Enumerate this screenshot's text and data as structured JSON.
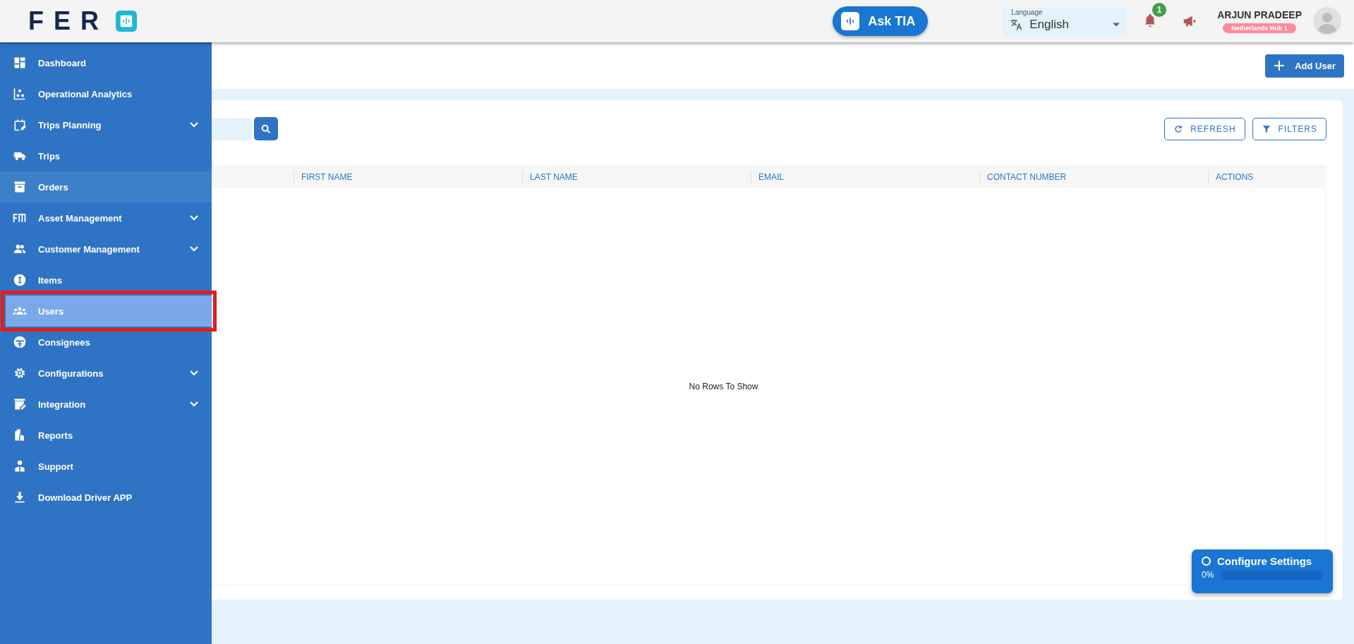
{
  "header": {
    "logo": "FER",
    "ask_button": "Ask TIA",
    "language": {
      "label": "Language",
      "value": "English"
    },
    "notification_count": "1",
    "user": {
      "name": "ARJUN PRADEEP",
      "hub": "Netherlands Hub 1"
    }
  },
  "sidebar": {
    "items": [
      {
        "label": "Dashboard",
        "kind": "dashboard",
        "expandable": false,
        "selected": false,
        "hovered": false,
        "marked": false
      },
      {
        "label": "Operational Analytics",
        "kind": "analytics",
        "expandable": false,
        "selected": false,
        "hovered": false,
        "marked": false
      },
      {
        "label": "Trips Planning",
        "kind": "calendar",
        "expandable": true,
        "selected": false,
        "hovered": false,
        "marked": false
      },
      {
        "label": "Trips",
        "kind": "truck",
        "expandable": false,
        "selected": false,
        "hovered": false,
        "marked": false
      },
      {
        "label": "Orders",
        "kind": "archive",
        "expandable": false,
        "selected": false,
        "hovered": true,
        "marked": false
      },
      {
        "label": "Asset Management",
        "kind": "fm",
        "expandable": true,
        "selected": false,
        "hovered": false,
        "marked": false
      },
      {
        "label": "Customer Management",
        "kind": "people",
        "expandable": true,
        "selected": false,
        "hovered": false,
        "marked": false
      },
      {
        "label": "Items",
        "kind": "info",
        "expandable": false,
        "selected": false,
        "hovered": false,
        "marked": false
      },
      {
        "label": "Users",
        "kind": "group",
        "expandable": false,
        "selected": true,
        "hovered": false,
        "marked": true
      },
      {
        "label": "Consignees",
        "kind": "face",
        "expandable": false,
        "selected": false,
        "hovered": false,
        "marked": false
      },
      {
        "label": "Configurations",
        "kind": "gear",
        "expandable": true,
        "selected": false,
        "hovered": false,
        "marked": false
      },
      {
        "label": "Integration",
        "kind": "edit",
        "expandable": true,
        "selected": false,
        "hovered": false,
        "marked": false
      },
      {
        "label": "Reports",
        "kind": "clipboard",
        "expandable": false,
        "selected": false,
        "hovered": false,
        "marked": false
      },
      {
        "label": "Support",
        "kind": "person",
        "expandable": false,
        "selected": false,
        "hovered": false,
        "marked": false
      },
      {
        "label": "Download Driver APP",
        "kind": "download",
        "expandable": false,
        "selected": false,
        "hovered": false,
        "marked": false
      }
    ]
  },
  "toolbar": {
    "add_button": "Add User"
  },
  "table": {
    "buttons": [
      {
        "label": "REFRESH",
        "kind": "refresh"
      },
      {
        "label": "FILTERS",
        "kind": "filter"
      }
    ],
    "columns": [
      "FIRST NAME",
      "LAST NAME",
      "EMAIL",
      "CONTACT NUMBER",
      "ACTIONS"
    ],
    "empty_message": "No Rows To Show"
  },
  "setup_widget": {
    "title": "Configure Settings",
    "reading": "0%",
    "level": 0
  }
}
